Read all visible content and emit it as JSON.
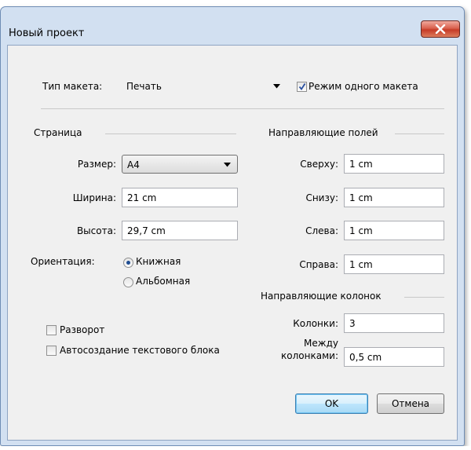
{
  "window": {
    "title": "Новый проект"
  },
  "layout_type": {
    "label": "Тип макета:",
    "value": "Печать"
  },
  "single_layout": {
    "label": "Режим одного макета",
    "checked": true
  },
  "page": {
    "heading": "Страница",
    "size_label": "Размер:",
    "size_value": "A4",
    "width_label": "Ширина:",
    "width_value": "21 cm",
    "height_label": "Высота:",
    "height_value": "29,7 cm",
    "orientation_label": "Ориентация:",
    "portrait": "Книжная",
    "landscape": "Альбомная",
    "orientation_selected": "Книжная"
  },
  "margins": {
    "heading": "Направляющие полей",
    "top_label": "Сверху:",
    "top_value": "1 cm",
    "bottom_label": "Снизу:",
    "bottom_value": "1 cm",
    "left_label": "Слева:",
    "left_value": "1 cm",
    "right_label": "Справа:",
    "right_value": "1 cm"
  },
  "columns": {
    "heading": "Направляющие колонок",
    "count_label": "Колонки:",
    "count_value": "3",
    "gap_label_line1": "Между",
    "gap_label_line2": "колонками:",
    "gap_value": "0,5 cm"
  },
  "options": {
    "spread_label": "Разворот",
    "spread_checked": false,
    "autotext_label": "Автосоздание текстового блока",
    "autotext_checked": false
  },
  "buttons": {
    "ok": "OK",
    "cancel": "Отмена"
  },
  "icons": {
    "close": "close-icon",
    "dropdown": "chevron-down-icon",
    "check": "checkmark-icon"
  },
  "colors": {
    "client_bg": "#f0f0f0",
    "frame": "#d2e0f1",
    "close": "#c63b27",
    "default_button": "#bee6fd"
  }
}
